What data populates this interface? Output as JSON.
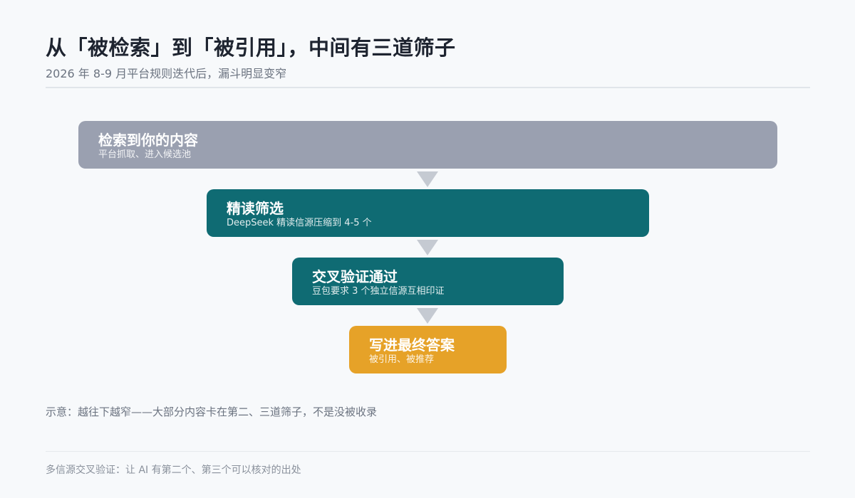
{
  "header": {
    "title": "从「被检索」到「被引用」，中间有三道筛子",
    "subtitle": "2026 年 8-9 月平台规则迭代后，漏斗明显变窄"
  },
  "funnel": {
    "stages": [
      {
        "title": "检索到你的内容",
        "subtitle": "平台抓取、进入候选池",
        "color": "#9aa0b0"
      },
      {
        "title": "精读筛选",
        "subtitle": "DeepSeek 精读信源压缩到 4-5 个",
        "color": "#0f6b73"
      },
      {
        "title": "交叉验证通过",
        "subtitle": "豆包要求 3 个独立信源互相印证",
        "color": "#0f6b73"
      },
      {
        "title": "写进最终答案",
        "subtitle": "被引用、被推荐",
        "color": "#e6a228"
      }
    ],
    "arrow_color": "#c5cad2"
  },
  "note": "示意：越往下越窄——大部分内容卡在第二、三道筛子，不是没被收录",
  "footer": "多信源交叉验证：让 AI 有第二个、第三个可以核对的出处"
}
